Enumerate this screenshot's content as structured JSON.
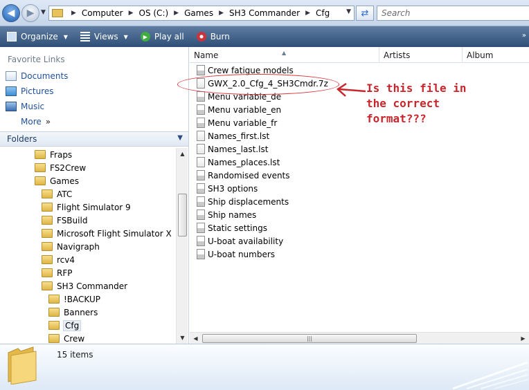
{
  "address": {
    "crumbs": [
      "Computer",
      "OS (C:)",
      "Games",
      "SH3 Commander",
      "Cfg"
    ],
    "search_placeholder": "Search"
  },
  "toolbar": {
    "organize": "Organize",
    "views": "Views",
    "play_all": "Play all",
    "burn": "Burn"
  },
  "favorites": {
    "title": "Favorite Links",
    "items": [
      "Documents",
      "Pictures",
      "Music",
      "More"
    ]
  },
  "folders": {
    "title": "Folders",
    "tree": [
      {
        "label": "Fraps",
        "level": 0
      },
      {
        "label": "FS2Crew",
        "level": 0
      },
      {
        "label": "Games",
        "level": 0
      },
      {
        "label": "ATC",
        "level": 1
      },
      {
        "label": "Flight Simulator 9",
        "level": 1
      },
      {
        "label": "FSBuild",
        "level": 1
      },
      {
        "label": "Microsoft Flight Simulator X",
        "level": 1
      },
      {
        "label": "Navigraph",
        "level": 1
      },
      {
        "label": "rcv4",
        "level": 1
      },
      {
        "label": "RFP",
        "level": 1
      },
      {
        "label": "SH3 Commander",
        "level": 1
      },
      {
        "label": "!BACKUP",
        "level": 2
      },
      {
        "label": "Banners",
        "level": 2
      },
      {
        "label": "Cfg",
        "level": 2,
        "selected": true
      },
      {
        "label": "Crew",
        "level": 2
      }
    ]
  },
  "columns": [
    "Name",
    "Artists",
    "Album"
  ],
  "files": [
    {
      "name": "Crew fatigue models",
      "type": "cfg"
    },
    {
      "name": "GWX_2.0_Cfg_4_SH3Cmdr.7z",
      "type": "blank"
    },
    {
      "name": "Menu variable_de",
      "type": "cfg"
    },
    {
      "name": "Menu variable_en",
      "type": "cfg"
    },
    {
      "name": "Menu variable_fr",
      "type": "cfg"
    },
    {
      "name": "Names_first.lst",
      "type": "blank"
    },
    {
      "name": "Names_last.lst",
      "type": "blank"
    },
    {
      "name": "Names_places.lst",
      "type": "blank"
    },
    {
      "name": "Randomised events",
      "type": "cfg"
    },
    {
      "name": "SH3 options",
      "type": "cfg"
    },
    {
      "name": "Ship displacements",
      "type": "cfg"
    },
    {
      "name": "Ship names",
      "type": "cfg"
    },
    {
      "name": "Static settings",
      "type": "cfg"
    },
    {
      "name": "U-boat availability",
      "type": "cfg"
    },
    {
      "name": "U-boat numbers",
      "type": "cfg"
    }
  ],
  "annotation": "Is this file in\nthe correct\nformat???",
  "status": {
    "items_count": "15 items"
  },
  "colors": {
    "annotation": "#c8262c",
    "toolbar": "#3a5a84",
    "link": "#1e4f9c"
  }
}
